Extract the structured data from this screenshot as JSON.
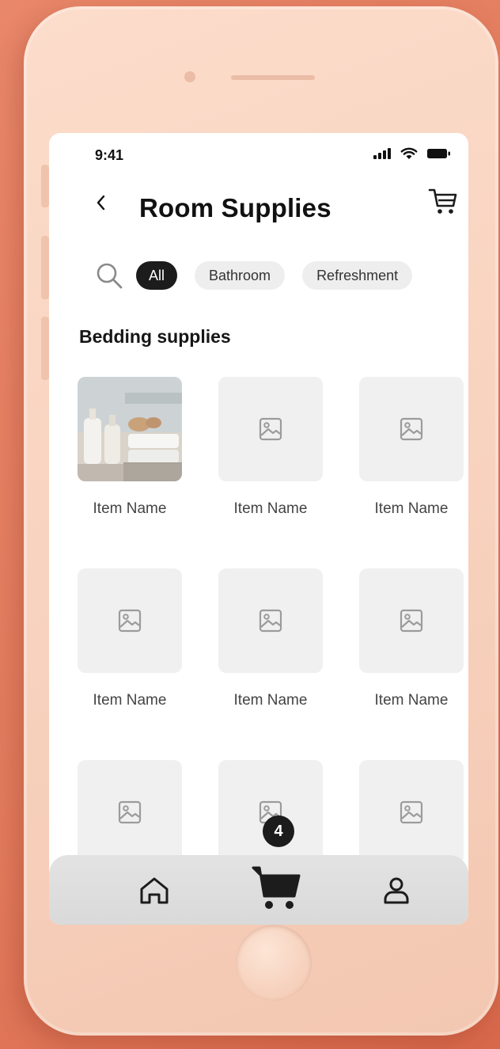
{
  "status": {
    "time": "9:41"
  },
  "header": {
    "title": "Room Supplies"
  },
  "filters": [
    {
      "label": "All",
      "active": true
    },
    {
      "label": "Bathroom",
      "active": false
    },
    {
      "label": "Refreshment",
      "active": false
    }
  ],
  "section": {
    "title": "Bedding supplies"
  },
  "items": [
    {
      "name": "Item Name",
      "has_photo": true
    },
    {
      "name": "Item Name",
      "has_photo": false
    },
    {
      "name": "Item Name",
      "has_photo": false
    },
    {
      "name": "Item Name",
      "has_photo": false
    },
    {
      "name": "Item Name",
      "has_photo": false
    },
    {
      "name": "Item Name",
      "has_photo": false
    },
    {
      "name": "",
      "has_photo": false
    },
    {
      "name": "",
      "has_photo": false
    },
    {
      "name": "",
      "has_photo": false
    }
  ],
  "nav": {
    "items": [
      {
        "icon": "home-icon"
      },
      {
        "icon": "cart-icon"
      },
      {
        "icon": "profile-icon"
      }
    ],
    "cart_count": "4"
  },
  "colors": {
    "background": "#e27a5c",
    "phone": "#f8d3bf",
    "accent_dark": "#1c1c1c",
    "placeholder": "#f0f0f0"
  }
}
